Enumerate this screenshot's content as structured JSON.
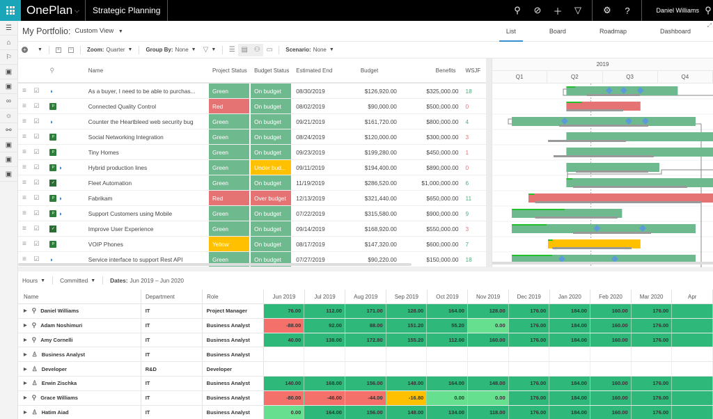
{
  "topbar": {
    "app_name": "OnePlan",
    "workspace": "Strategic Planning",
    "user_name": "Daniel Williams",
    "icons": [
      "search-icon",
      "goal-icon",
      "add-icon",
      "filter-icon",
      "settings-icon",
      "help-icon",
      "person-icon"
    ]
  },
  "sidebar": {
    "items": [
      "menu-icon",
      "home-icon",
      "strategy-icon",
      "clipboard-icon",
      "clipboard-icon",
      "binoculars-icon",
      "lightbulb-icon",
      "network-icon",
      "clipboard-icon",
      "clipboard-icon",
      "clipboard-icon"
    ]
  },
  "header": {
    "title": "My Portfolio:",
    "view": "Custom View",
    "tabs": [
      {
        "label": "List",
        "active": true
      },
      {
        "label": "Board",
        "active": false
      },
      {
        "label": "Roadmap",
        "active": false
      },
      {
        "label": "Dashboard",
        "active": false
      }
    ]
  },
  "toolbar": {
    "zoom_label": "Zoom:",
    "zoom_value": "Quarter",
    "groupby_label": "Group By:",
    "groupby_value": "None",
    "scenario_label": "Scenario:",
    "scenario_value": "None"
  },
  "grid": {
    "columns": {
      "name": "Name",
      "project_status": "Project Status",
      "budget_status": "Budget Status",
      "estimated_end": "Estimated End",
      "budget": "Budget",
      "benefits": "Benefits",
      "wsjf": "WSJF"
    },
    "rows": [
      {
        "name": "As a buyer, I need to be able to purchas...",
        "icons": [
          "ado"
        ],
        "project_status": "Green",
        "budget_status": "On budget",
        "end": "08/30/2019",
        "budget": "$126,920.00",
        "benefits": "$325,000.00",
        "wsjf": "18",
        "wsjf_color": "#4caf7d"
      },
      {
        "name": "Connected Quality Control",
        "icons": [
          "project"
        ],
        "project_status": "Red",
        "budget_status": "On budget",
        "end": "08/02/2019",
        "budget": "$90,000.00",
        "benefits": "$500,000.00",
        "wsjf": "0",
        "wsjf_color": "#e57373"
      },
      {
        "name": "Counter the Heartbleed web security bug",
        "icons": [
          "ado"
        ],
        "project_status": "Green",
        "budget_status": "On budget",
        "end": "09/21/2019",
        "budget": "$161,720.00",
        "benefits": "$800,000.00",
        "wsjf": "4",
        "wsjf_color": "#4caf7d"
      },
      {
        "name": "Social Networking Integration",
        "icons": [
          "project"
        ],
        "project_status": "Green",
        "budget_status": "On budget",
        "end": "08/24/2019",
        "budget": "$120,000.00",
        "benefits": "$300,000.00",
        "wsjf": "3",
        "wsjf_color": "#e57373"
      },
      {
        "name": "Tiny Homes",
        "icons": [
          "project"
        ],
        "project_status": "Green",
        "budget_status": "On budget",
        "end": "09/23/2019",
        "budget": "$199,280.00",
        "benefits": "$450,000.00",
        "wsjf": "1",
        "wsjf_color": "#e57373"
      },
      {
        "name": "Hybrid production lines",
        "icons": [
          "project",
          "ado"
        ],
        "project_status": "Green",
        "budget_status": "Under bud...",
        "end": "09/11/2019",
        "budget": "$194,400.00",
        "benefits": "$890,000.00",
        "wsjf": "0",
        "wsjf_color": "#e57373"
      },
      {
        "name": "Fleet Automation",
        "icons": [
          "planner"
        ],
        "project_status": "Green",
        "budget_status": "On budget",
        "end": "11/19/2019",
        "budget": "$286,520.00",
        "benefits": "$1,000,000.00",
        "wsjf": "6",
        "wsjf_color": "#4caf7d"
      },
      {
        "name": "Fabrikam",
        "icons": [
          "project",
          "ado"
        ],
        "project_status": "Red",
        "budget_status": "Over budget",
        "end": "12/13/2019",
        "budget": "$321,440.00",
        "benefits": "$650,000.00",
        "wsjf": "11",
        "wsjf_color": "#4caf7d"
      },
      {
        "name": "Support Customers using Mobile",
        "icons": [
          "project",
          "ado"
        ],
        "project_status": "Green",
        "budget_status": "On budget",
        "end": "07/22/2019",
        "budget": "$315,580.00",
        "benefits": "$900,000.00",
        "wsjf": "9",
        "wsjf_color": "#4caf7d"
      },
      {
        "name": "Improve User Experience",
        "icons": [
          "planner"
        ],
        "project_status": "Green",
        "budget_status": "On budget",
        "end": "09/14/2019",
        "budget": "$168,920.00",
        "benefits": "$550,000.00",
        "wsjf": "3",
        "wsjf_color": "#e57373"
      },
      {
        "name": "VOIP Phones",
        "icons": [
          "project"
        ],
        "project_status": "Yellow",
        "budget_status": "On budget",
        "end": "08/17/2019",
        "budget": "$147,320.00",
        "benefits": "$600,000.00",
        "wsjf": "7",
        "wsjf_color": "#4caf7d"
      },
      {
        "name": "Service interface to support Rest API",
        "icons": [
          "ado"
        ],
        "project_status": "Green",
        "budget_status": "On budget",
        "end": "07/27/2019",
        "budget": "$90,220.00",
        "benefits": "$150,000.00",
        "wsjf": "18",
        "wsjf_color": "#4caf7d"
      }
    ],
    "status_colors": {
      "Green": "#6fb98f",
      "Red": "#e57373",
      "Yellow": "#ffc000",
      "On budget": "#6fb98f",
      "Over budget": "#e57373",
      "Under bud...": "#ffc000"
    }
  },
  "gantt": {
    "year": "2019",
    "quarters": [
      "Q1",
      "Q2",
      "Q3",
      "Q4"
    ],
    "today_marker_quarter": 1.77,
    "bars": [
      {
        "start": 1.33,
        "end": 3.33,
        "color": "#6fb98f",
        "progress": 0.08,
        "baseline": [
          1.7,
          2.65
        ],
        "milestones": [
          2.1,
          2.36,
          2.66
        ]
      },
      {
        "start": 1.33,
        "end": 2.66,
        "color": "#e57373",
        "progress": 0.21,
        "baseline": [
          1.33,
          2.35
        ],
        "milestones": []
      },
      {
        "start": 0.35,
        "end": 3.65,
        "color": "#6fb98f",
        "progress": 0,
        "baseline": [
          1.2,
          2.8
        ],
        "milestones": [
          1.3,
          2.45,
          2.75
        ]
      },
      {
        "start": 1.33,
        "end": 4.0,
        "color": "#6fb98f",
        "progress": 0,
        "baseline": [
          1.0,
          2.4
        ],
        "milestones": []
      },
      {
        "start": 1.33,
        "end": 4.0,
        "color": "#6fb98f",
        "progress": 0,
        "baseline": [
          1.1,
          2.9
        ],
        "milestones": []
      },
      {
        "start": 1.33,
        "end": 3.0,
        "color": "#6fb98f",
        "progress": 0,
        "baseline": [
          1.5,
          2.8
        ],
        "milestones": []
      },
      {
        "start": 1.33,
        "end": 4.0,
        "color": "#6fb98f",
        "progress": 0.04,
        "baseline": [
          1.45,
          3.5
        ],
        "milestones": []
      },
      {
        "start": 0.65,
        "end": 4.0,
        "color": "#e57373",
        "progress": 0.03,
        "baseline": [
          0.77,
          3.75
        ],
        "milestones": []
      },
      {
        "start": 0.35,
        "end": 2.33,
        "color": "#6fb98f",
        "progress": 0.48,
        "baseline": [
          0.77,
          2.25
        ],
        "milestones": []
      },
      {
        "start": 0.35,
        "end": 3.65,
        "color": "#6fb98f",
        "progress": 0.19,
        "baseline": [
          1.45,
          2.85
        ],
        "milestones": [
          1.88,
          2.7
        ]
      },
      {
        "start": 1.0,
        "end": 2.66,
        "color": "#ffc000",
        "progress": 0.05,
        "baseline": [
          1.08,
          2.5
        ],
        "milestones": []
      },
      {
        "start": 0.35,
        "end": 3.65,
        "color": "#6fb98f",
        "progress": 0.22,
        "baseline": [],
        "milestones": [
          1.25,
          2.2
        ]
      }
    ]
  },
  "resources": {
    "toolbar": {
      "unit": "Hours",
      "mode": "Committed",
      "dates_label": "Dates:",
      "dates_value": "Jun 2019 – Jun 2020"
    },
    "columns": {
      "name": "Name",
      "department": "Department",
      "role": "Role"
    },
    "months": [
      "Jun 2019",
      "Jul 2019",
      "Aug 2019",
      "Sep 2019",
      "Oct 2019",
      "Nov 2019",
      "Dec 2019",
      "Jan 2020",
      "Feb 2020",
      "Mar 2020",
      "Apr"
    ],
    "rows": [
      {
        "name": "Daniel Williams",
        "type": "person",
        "department": "IT",
        "role": "Project Manager",
        "values": [
          "76.00",
          "112.00",
          "171.00",
          "128.00",
          "164.00",
          "128.00",
          "176.00",
          "184.00",
          "160.00",
          "176.00",
          ""
        ],
        "levels": [
          "g",
          "g",
          "g",
          "g",
          "g",
          "g",
          "g",
          "g",
          "g",
          "g",
          "g"
        ]
      },
      {
        "name": "Adam Noshimuri",
        "type": "person",
        "department": "IT",
        "role": "Business Analyst",
        "values": [
          "-88.00",
          "92.00",
          "88.00",
          "151.20",
          "55.20",
          "0.00",
          "176.00",
          "184.00",
          "160.00",
          "176.00",
          ""
        ],
        "levels": [
          "r",
          "g",
          "g",
          "g",
          "g",
          "l",
          "g",
          "g",
          "g",
          "g",
          "g"
        ]
      },
      {
        "name": "Amy Cornelli",
        "type": "person",
        "department": "IT",
        "role": "Business Analyst",
        "values": [
          "40.00",
          "138.00",
          "172.80",
          "155.20",
          "112.00",
          "160.00",
          "176.00",
          "184.00",
          "160.00",
          "176.00",
          ""
        ],
        "levels": [
          "g",
          "g",
          "g",
          "g",
          "g",
          "g",
          "g",
          "g",
          "g",
          "g",
          "g"
        ]
      },
      {
        "name": "Business Analyst",
        "type": "generic",
        "department": "IT",
        "role": "Business Analyst",
        "values": [
          "",
          "",
          "",
          "",
          "",
          "",
          "",
          "",
          "",
          "",
          ""
        ],
        "levels": [
          "w",
          "w",
          "w",
          "w",
          "w",
          "w",
          "w",
          "w",
          "w",
          "w",
          "w"
        ]
      },
      {
        "name": "Developer",
        "type": "generic",
        "department": "R&D",
        "role": "Developer",
        "values": [
          "",
          "",
          "",
          "",
          "",
          "",
          "",
          "",
          "",
          "",
          ""
        ],
        "levels": [
          "w",
          "w",
          "w",
          "w",
          "w",
          "w",
          "w",
          "w",
          "w",
          "w",
          "w"
        ]
      },
      {
        "name": "Erwin Zischka",
        "type": "generic",
        "department": "IT",
        "role": "Business Analyst",
        "values": [
          "140.00",
          "168.00",
          "156.00",
          "148.00",
          "164.00",
          "148.00",
          "176.00",
          "184.00",
          "160.00",
          "176.00",
          ""
        ],
        "levels": [
          "g",
          "g",
          "g",
          "g",
          "g",
          "g",
          "g",
          "g",
          "g",
          "g",
          "g"
        ]
      },
      {
        "name": "Grace Williams",
        "type": "person",
        "department": "IT",
        "role": "Business Analyst",
        "values": [
          "-80.00",
          "-46.00",
          "-44.00",
          "-16.80",
          "0.00",
          "0.00",
          "176.00",
          "184.00",
          "160.00",
          "176.00",
          ""
        ],
        "levels": [
          "r",
          "r",
          "r",
          "y",
          "l",
          "l",
          "g",
          "g",
          "g",
          "g",
          "g"
        ]
      },
      {
        "name": "Hatim Aiad",
        "type": "generic",
        "department": "IT",
        "role": "Business Analyst",
        "values": [
          "0.00",
          "164.00",
          "156.00",
          "148.00",
          "134.00",
          "118.00",
          "176.00",
          "184.00",
          "160.00",
          "176.00",
          ""
        ],
        "levels": [
          "l",
          "g",
          "g",
          "g",
          "g",
          "g",
          "g",
          "g",
          "g",
          "g",
          "g"
        ]
      }
    ],
    "level_colors": {
      "g": "#2eb87a",
      "r": "#f4716b",
      "y": "#ffc000",
      "l": "#66e08f",
      "w": "#ffffff"
    }
  }
}
